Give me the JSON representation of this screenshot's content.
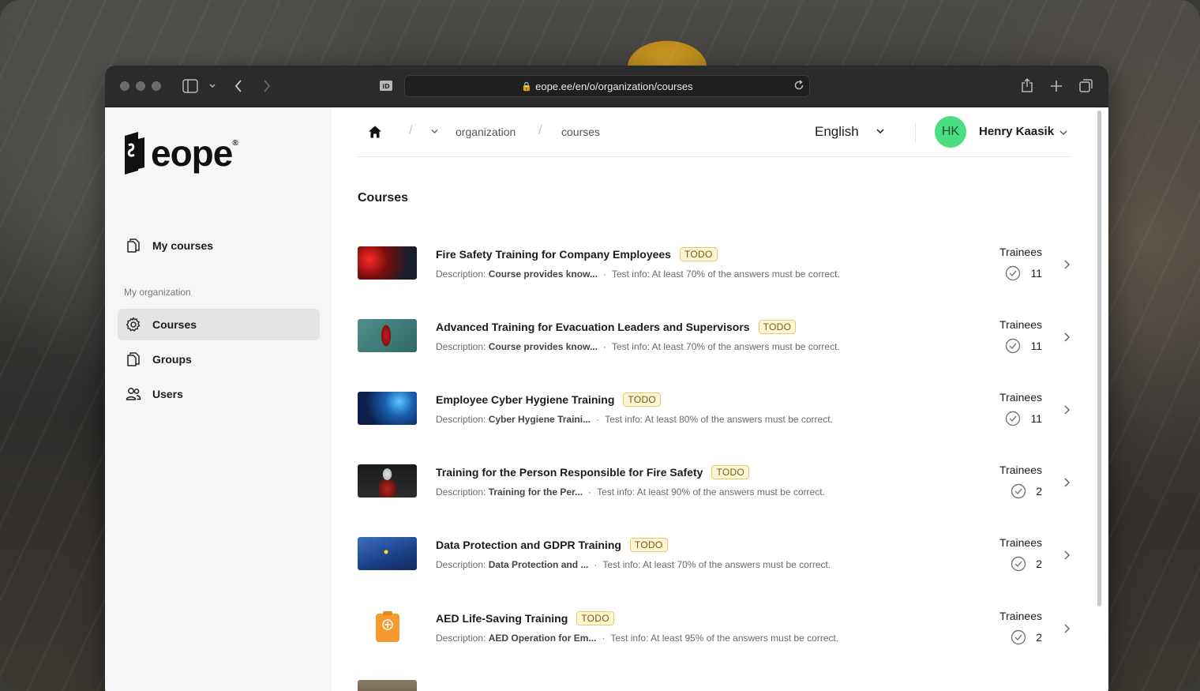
{
  "browser": {
    "url": "eope.ee/en/o/organization/courses"
  },
  "sidebar": {
    "logo": "eope",
    "logo_mark": "®",
    "items": [
      {
        "label": "My courses",
        "icon": "documents-icon"
      },
      {
        "label": "Courses",
        "icon": "gear-icon",
        "active": true
      },
      {
        "label": "Groups",
        "icon": "documents-icon"
      },
      {
        "label": "Users",
        "icon": "users-icon"
      }
    ],
    "section_label": "My organization"
  },
  "topbar": {
    "breadcrumb": [
      "organization",
      "courses"
    ],
    "language": "English",
    "user_initials": "HK",
    "user_name": "Henry Kaasik",
    "avatar_color": "#4ade80"
  },
  "main": {
    "title": "Courses",
    "trainees_label": "Trainees",
    "desc_prefix": "Description:",
    "courses": [
      {
        "title": "Fire Safety Training for Company Employees",
        "status": "TODO",
        "description": "Course provides know...",
        "test_info": "Test info: At least 70% of the answers must be correct.",
        "trainees": "11"
      },
      {
        "title": "Advanced Training for Evacuation Leaders and Supervisors",
        "status": "TODO",
        "description": "Course provides know...",
        "test_info": "Test info: At least 70% of the answers must be correct.",
        "trainees": "11"
      },
      {
        "title": "Employee Cyber Hygiene Training",
        "status": "TODO",
        "description": "Cyber Hygiene Traini...",
        "test_info": "Test info: At least 80% of the answers must be correct.",
        "trainees": "11"
      },
      {
        "title": "Training for the Person Responsible for Fire Safety",
        "status": "TODO",
        "description": "Training for the Per...",
        "test_info": "Test info: At least 90% of the answers must be correct.",
        "trainees": "2"
      },
      {
        "title": "Data Protection and GDPR Training",
        "status": "TODO",
        "description": "Data Protection and ...",
        "test_info": "Test info: At least 70% of the answers must be correct.",
        "trainees": "2"
      },
      {
        "title": "AED Life-Saving Training",
        "status": "TODO",
        "description": "AED Operation for Em...",
        "test_info": "Test info: At least 95% of the answers must be correct.",
        "trainees": "2"
      }
    ]
  },
  "colors": {
    "badge_bg": "#fef6d4",
    "badge_border": "#e9c96a",
    "active_nav": "#e4e4e6"
  }
}
